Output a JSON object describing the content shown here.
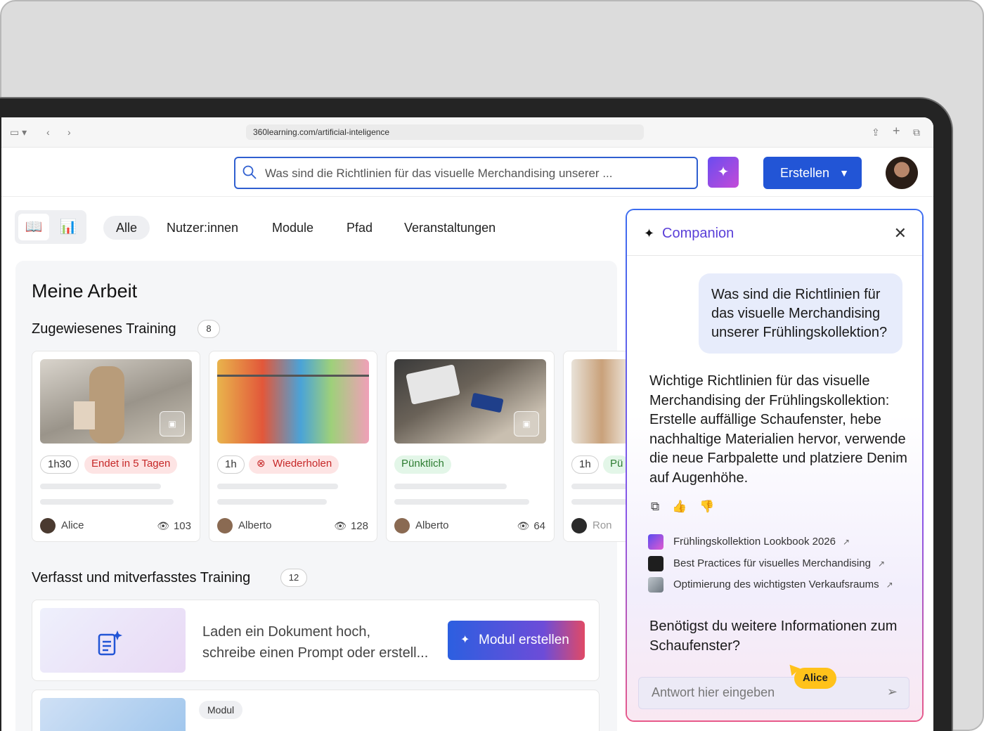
{
  "browser": {
    "url": "360learning.com/artificial-inteligence"
  },
  "header": {
    "search_query": "Was sind die Richtlinien für das visuelle Merchandising unserer ...",
    "create_label": "Erstellen"
  },
  "filters": {
    "tabs": [
      "Alle",
      "Nutzer:innen",
      "Module",
      "Pfad",
      "Veranstaltungen"
    ],
    "selected": "Alle"
  },
  "main": {
    "title": "Meine Arbeit",
    "assigned": {
      "title": "Zugewiesenes Training",
      "count": "8",
      "cards": [
        {
          "duration": "1h30",
          "status": "Endet in 5 Tagen",
          "author": "Alice",
          "views": "103"
        },
        {
          "duration": "1h",
          "status": "Wiederholen",
          "author": "Alberto",
          "views": "128"
        },
        {
          "duration": "",
          "status": "Pünktlich",
          "author": "Alberto",
          "views": "64"
        },
        {
          "duration": "1h",
          "status": "Pü",
          "author": "Ron",
          "views": ""
        }
      ]
    },
    "authored": {
      "title": "Verfasst und mitverfasstes Training",
      "count": "12",
      "promo_text_1": "Laden ein Dokument hoch,",
      "promo_text_2": "schreibe einen Prompt oder erstell...",
      "promo_button": "Modul erstellen",
      "next_tag": "Modul"
    }
  },
  "companion": {
    "title": "Companion",
    "question": "Was sind die Richtlinien für das visuelle Merchandising unserer Frühlingskollektion?",
    "answer": "Wichtige Richtlinien für das visuelle Merchandising der Frühlingskollektion: Erstelle auffällige Schaufenster, hebe nachhaltige Materialien hervor, verwende die neue Farbpalette und platziere Denim auf Augenhöhe.",
    "sources": [
      "Frühlingskollektion Lookbook 2026",
      "Best Practices für visuelles Merchandising",
      "Optimierung des wichtigsten Verkaufsraums"
    ],
    "followup": "Benötigst du weitere Informationen zum Schaufenster?",
    "input_placeholder": "Antwort hier eingeben",
    "cursor_label": "Alice"
  },
  "colors": {
    "accent": "#2255d6",
    "companion_purple": "#5a3fd8",
    "status_red": "#c62828",
    "status_green": "#2e7d32",
    "cursor_yellow": "#ffc21a"
  }
}
